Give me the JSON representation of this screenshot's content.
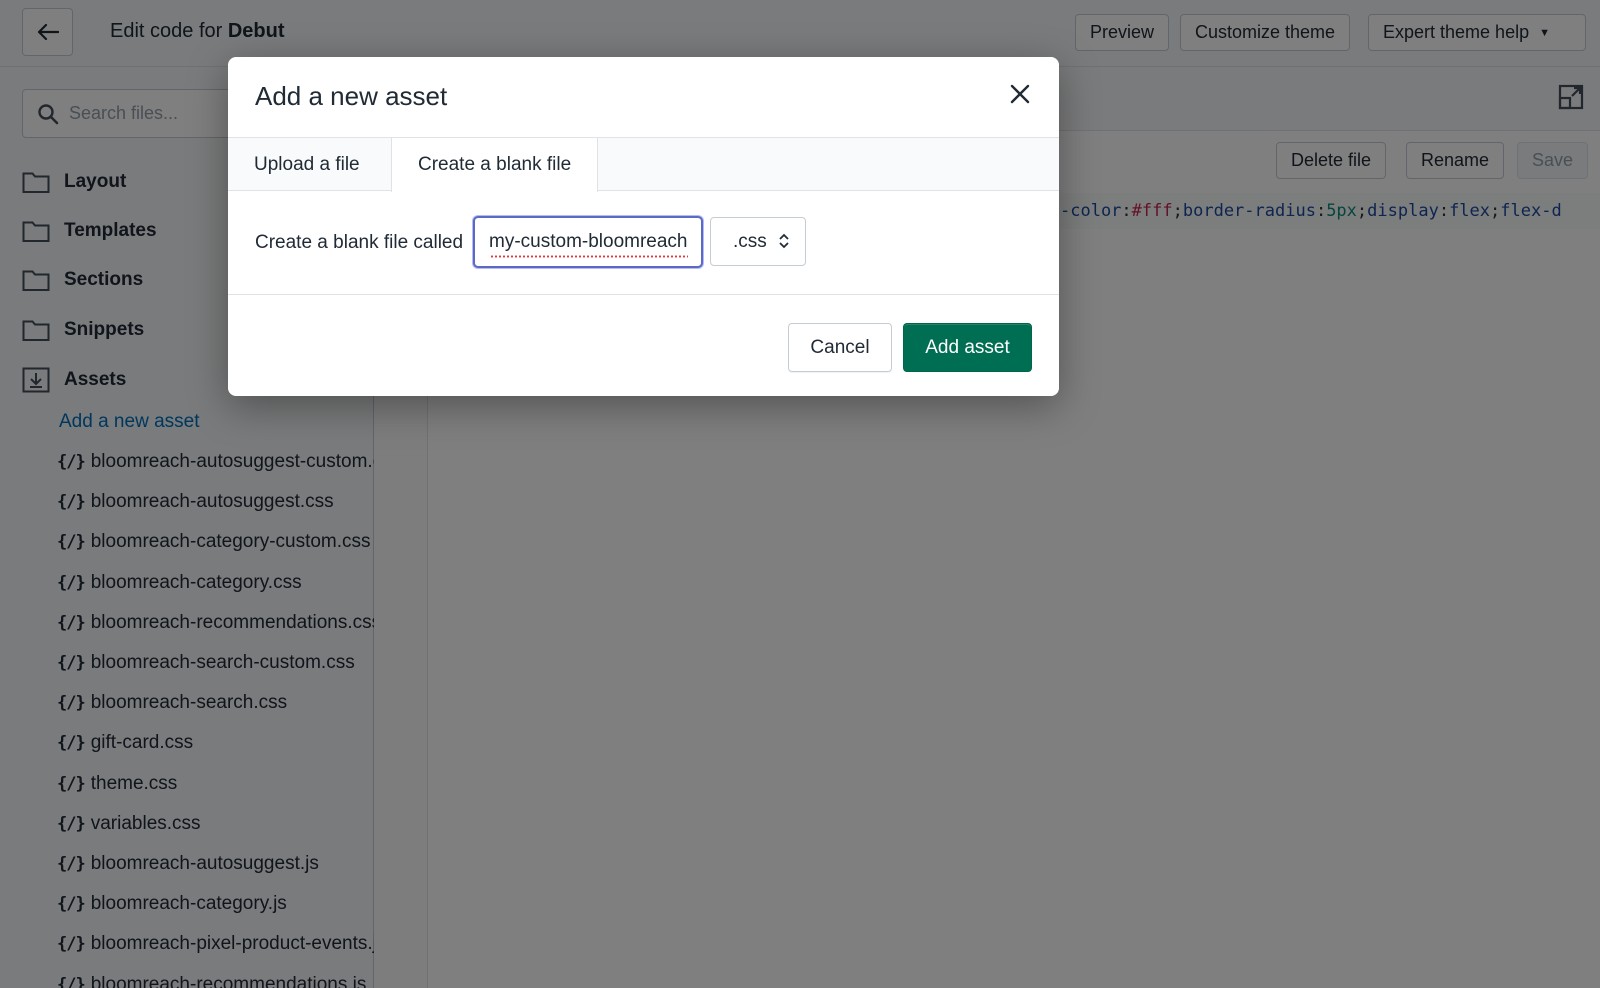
{
  "header": {
    "title_prefix": "Edit code for",
    "theme_name": "Debut",
    "preview_label": "Preview",
    "customize_label": "Customize theme",
    "expert_help_label": "Expert theme help"
  },
  "search": {
    "placeholder": "Search files..."
  },
  "sidebar": {
    "folders": [
      "Layout",
      "Templates",
      "Sections",
      "Snippets",
      "Assets"
    ],
    "add_asset_link": "Add a new asset",
    "file_icon_text": "{/}",
    "files": [
      "bloomreach-autosuggest-custom.css",
      "bloomreach-autosuggest.css",
      "bloomreach-category-custom.css",
      "bloomreach-category.css",
      "bloomreach-recommendations.css",
      "bloomreach-search-custom.css",
      "bloomreach-search.css",
      "gift-card.css",
      "theme.css",
      "variables.css",
      "bloomreach-autosuggest.js",
      "bloomreach-category.js",
      "bloomreach-pixel-product-events.js",
      "bloomreach-recommendations.js"
    ]
  },
  "editor": {
    "delete_label": "Delete file",
    "rename_label": "Rename",
    "save_label": "Save",
    "code_tokens": {
      "t1": "-color",
      "t2": ":",
      "t3": "#fff",
      "t4": ";",
      "t5": "border-radius",
      "t6": ":",
      "t7": "5px",
      "t8": ";",
      "t9": "display",
      "t10": ":",
      "t11": "flex",
      "t12": ";",
      "t13": "flex-d"
    }
  },
  "modal": {
    "title": "Add a new asset",
    "tabs": [
      "Upload a file",
      "Create a blank file"
    ],
    "form_label": "Create a blank file called",
    "file_name_value": "my-custom-bloomreach",
    "extension": ".css",
    "cancel_label": "Cancel",
    "add_label": "Add asset"
  },
  "colors": {
    "primary_green": "#006e52",
    "link_blue": "#006fbb",
    "focus_ring": "#5c6ac4"
  }
}
